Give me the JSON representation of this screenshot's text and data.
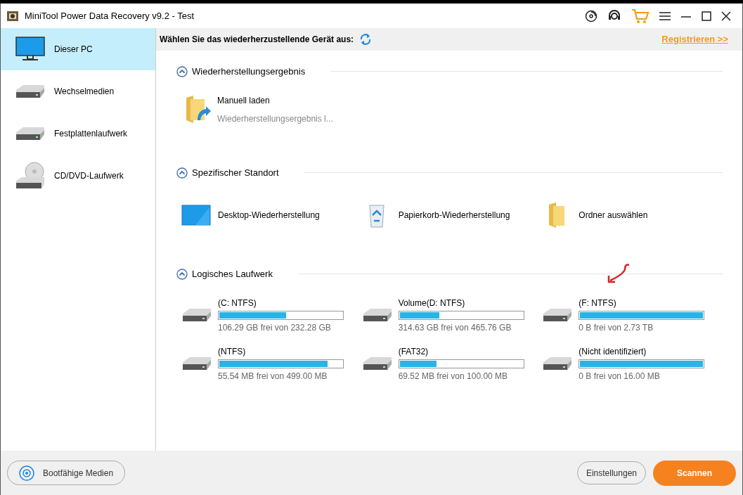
{
  "window": {
    "title": "MiniTool Power Data Recovery v9.2 - Test"
  },
  "sidebar": {
    "items": [
      {
        "label": "Dieser PC",
        "kind": "pc",
        "selected": true
      },
      {
        "label": "Wechselmedien",
        "kind": "removable",
        "selected": false
      },
      {
        "label": "Festplattenlaufwerk",
        "kind": "hdd",
        "selected": false
      },
      {
        "label": "CD/DVD-Laufwerk",
        "kind": "cd",
        "selected": false
      }
    ]
  },
  "header": {
    "prompt": "Wählen Sie das wiederherzustellende Gerät aus:",
    "register_link": "Registrieren >>"
  },
  "sections": [
    {
      "title": "Wiederherstellungsergebnis",
      "expanded": true,
      "kind": "result",
      "items": [
        {
          "label": "Manuell laden",
          "sublabel": "Wiederherstellungsergebnis l..."
        }
      ]
    },
    {
      "title": "Spezifischer Standort",
      "expanded": true,
      "kind": "locations",
      "items": [
        {
          "kind": "desktop",
          "label": "Desktop-Wiederherstellung"
        },
        {
          "kind": "recycle",
          "label": "Papierkorb-Wiederherstellung"
        },
        {
          "kind": "folder",
          "label": "Ordner auswählen"
        }
      ]
    },
    {
      "title": "Logisches Laufwerk",
      "expanded": true,
      "kind": "drives",
      "items": [
        {
          "label": "(C: NTFS)",
          "level": 0.54,
          "reading": "106.29 GB frei von 232.28 GB"
        },
        {
          "label": "Volume(D: NTFS)",
          "level": 0.32,
          "reading": "314.63 GB frei von 465.76 GB"
        },
        {
          "label": "(F: NTFS)",
          "level": 1,
          "reading": "0 B frei von 2.73 TB",
          "annotated": true
        },
        {
          "label": "(NTFS)",
          "level": 0.88,
          "reading": "55.54 MB frei von 499.00 MB"
        },
        {
          "label": "(FAT32)",
          "level": 0.3,
          "reading": "69.52 MB frei von 100.00 MB"
        },
        {
          "label": "(Nicht identifiziert)",
          "level": 1,
          "reading": "0 B frei von 16.00 MB"
        }
      ]
    }
  ],
  "footer": {
    "bootable_button": "Bootfähige Medien",
    "settings_button": "Einstellungen",
    "scan_button": "Scannen"
  }
}
